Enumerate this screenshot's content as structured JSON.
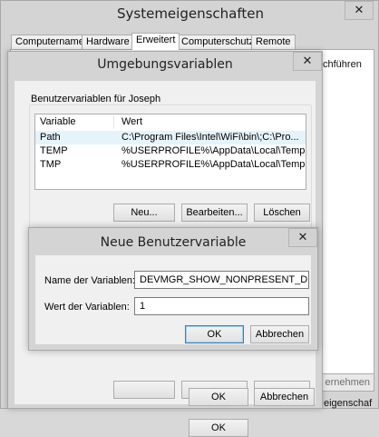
{
  "system_properties": {
    "title": "Systemeigenschaften",
    "tabs": [
      {
        "label": "Computername"
      },
      {
        "label": "Hardware"
      },
      {
        "label": "Erweitert"
      },
      {
        "label": "Computerschutz"
      },
      {
        "label": "Remote"
      }
    ],
    "right_edge_text": "chführen",
    "bottom_partial_button": "ernehmen",
    "bottom_edge_text": "eigenschaf"
  },
  "env_vars": {
    "title": "Umgebungsvariablen",
    "close_icon": "close-icon",
    "user_group_label": "Benutzervariablen für Joseph",
    "columns": [
      "Variable",
      "Wert"
    ],
    "rows": [
      {
        "variable": "Path",
        "value": "C:\\Program Files\\Intel\\WiFi\\bin\\;C:\\Pro..."
      },
      {
        "variable": "TEMP",
        "value": "%USERPROFILE%\\AppData\\Local\\Temp"
      },
      {
        "variable": "TMP",
        "value": "%USERPROFILE%\\AppData\\Local\\Temp"
      }
    ],
    "buttons": {
      "new": "Neu...",
      "edit": "Bearbeiten...",
      "delete": "Löschen"
    },
    "ok": "OK",
    "cancel": "Abbrechen",
    "selected_row_color": "#e5f3fb"
  },
  "new_var": {
    "title": "Neue Benutzervariable",
    "close_icon": "close-icon",
    "name_label": "Name der Variablen:",
    "name_value": "DEVMGR_SHOW_NONPRESENT_DEVICES",
    "value_label": "Wert der Variablen:",
    "value_value": "1",
    "ok": "OK",
    "cancel": "Abbrechen"
  }
}
